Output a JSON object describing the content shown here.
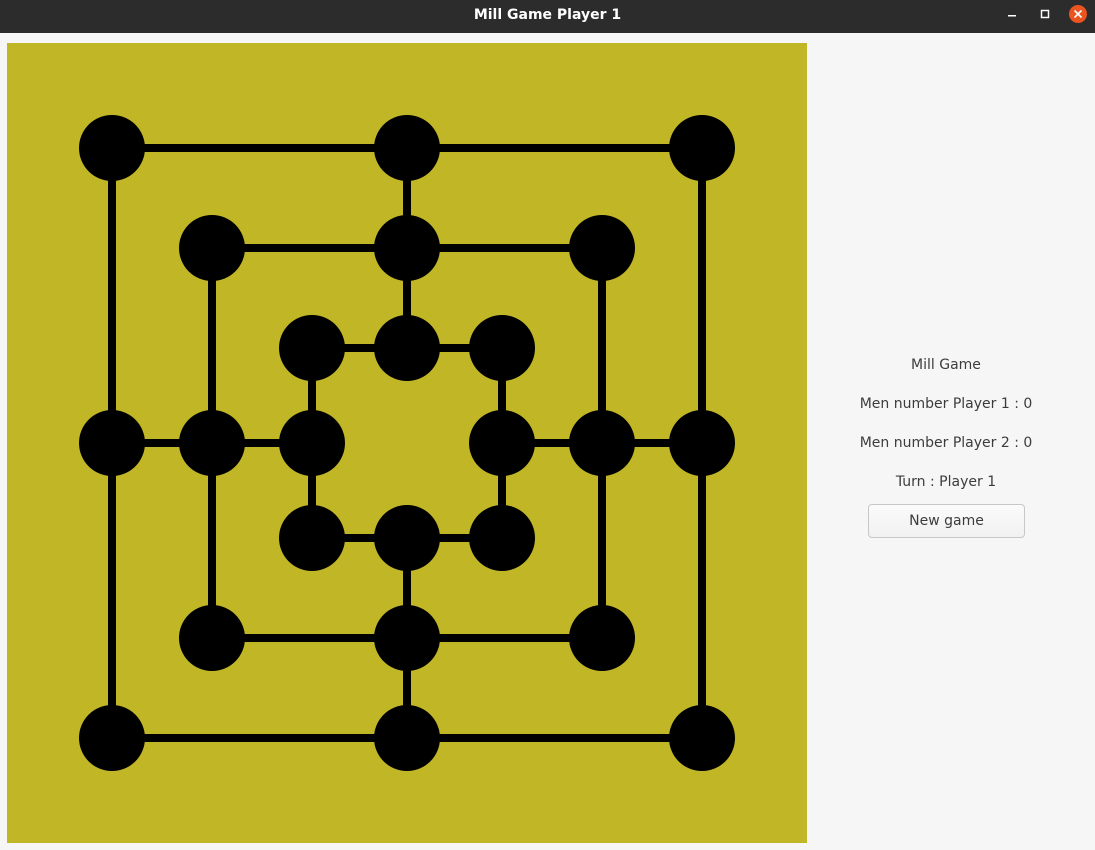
{
  "window": {
    "title": "Mill Game Player 1",
    "controls": [
      "minimize-icon",
      "maximize-icon",
      "close-icon"
    ]
  },
  "colors": {
    "titlebar": "#2c2c2c",
    "board_background": "#c1b626",
    "board_lines": "#000000",
    "board_points": "#000000",
    "close_button": "#e95420",
    "panel_background": "#f6f6f6"
  },
  "board": {
    "rings": 3,
    "points_per_ring": 8,
    "pieces_placed": 0
  },
  "panel": {
    "title": "Mill Game",
    "men_player1": "Men number Player 1 : 0",
    "men_player2": "Men number Player 2 : 0",
    "turn": "Turn : Player 1",
    "new_game_label": "New game"
  }
}
